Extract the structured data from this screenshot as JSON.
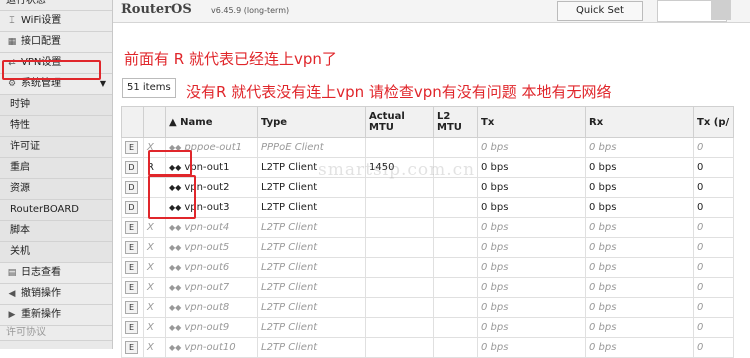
{
  "sidebar": {
    "top_cut": "运行状态",
    "items": [
      {
        "label": "WiFi设置",
        "icon": "wifi-icon",
        "glyph": "⌶"
      },
      {
        "label": "接口配置",
        "icon": "interface-icon",
        "glyph": "▦"
      },
      {
        "label": "VPN设置",
        "icon": "vpn-icon",
        "glyph": "⇄"
      },
      {
        "label": "系统管理",
        "icon": "gear-icon",
        "glyph": "⚙",
        "arrow": "▼"
      }
    ],
    "sub_items": [
      "时钟",
      "特性",
      "许可证",
      "重启",
      "资源",
      "RouterBOARD",
      "脚本",
      "关机"
    ],
    "bottom_items": [
      {
        "label": "日志查看",
        "icon": "log-icon",
        "glyph": "▤"
      },
      {
        "label": "撤销操作",
        "icon": "undo-icon",
        "glyph": "◀"
      },
      {
        "label": "重新操作",
        "icon": "redo-icon",
        "glyph": "▶"
      }
    ],
    "bottom_cut": "许可协议"
  },
  "header": {
    "brand": "RouterOS",
    "version": "v6.45.9 (long-term)",
    "quick_set": "Quick Set"
  },
  "annotations": {
    "line1": "前面有 R  就代表已经连上vpn了",
    "line2": "没有R 就代表没有连上vpn    请检查vpn有没有问题  本地有无网络"
  },
  "count_label": "51 items",
  "watermark": "smartsip.com.cn",
  "table": {
    "columns": [
      "",
      "",
      "▲ Name",
      "Type",
      "Actual MTU",
      "L2 MTU",
      "Tx",
      "Rx",
      "Tx (p/"
    ],
    "rows": [
      {
        "btn": "E",
        "flag": "X",
        "name": "pppoe-out1",
        "type": "PPPoE Client",
        "mtu": "",
        "l2mtu": "",
        "tx": "0 bps",
        "rx": "0 bps",
        "txp": "0",
        "disabled": true
      },
      {
        "btn": "D",
        "flag": "R",
        "name": "vpn-out1",
        "type": "L2TP Client",
        "mtu": "1450",
        "l2mtu": "",
        "tx": "0 bps",
        "rx": "0 bps",
        "txp": "0",
        "disabled": false
      },
      {
        "btn": "D",
        "flag": "",
        "name": "vpn-out2",
        "type": "L2TP Client",
        "mtu": "",
        "l2mtu": "",
        "tx": "0 bps",
        "rx": "0 bps",
        "txp": "0",
        "disabled": false
      },
      {
        "btn": "D",
        "flag": "",
        "name": "vpn-out3",
        "type": "L2TP Client",
        "mtu": "",
        "l2mtu": "",
        "tx": "0 bps",
        "rx": "0 bps",
        "txp": "0",
        "disabled": false
      },
      {
        "btn": "E",
        "flag": "X",
        "name": "vpn-out4",
        "type": "L2TP Client",
        "mtu": "",
        "l2mtu": "",
        "tx": "0 bps",
        "rx": "0 bps",
        "txp": "0",
        "disabled": true
      },
      {
        "btn": "E",
        "flag": "X",
        "name": "vpn-out5",
        "type": "L2TP Client",
        "mtu": "",
        "l2mtu": "",
        "tx": "0 bps",
        "rx": "0 bps",
        "txp": "0",
        "disabled": true
      },
      {
        "btn": "E",
        "flag": "X",
        "name": "vpn-out6",
        "type": "L2TP Client",
        "mtu": "",
        "l2mtu": "",
        "tx": "0 bps",
        "rx": "0 bps",
        "txp": "0",
        "disabled": true
      },
      {
        "btn": "E",
        "flag": "X",
        "name": "vpn-out7",
        "type": "L2TP Client",
        "mtu": "",
        "l2mtu": "",
        "tx": "0 bps",
        "rx": "0 bps",
        "txp": "0",
        "disabled": true
      },
      {
        "btn": "E",
        "flag": "X",
        "name": "vpn-out8",
        "type": "L2TP Client",
        "mtu": "",
        "l2mtu": "",
        "tx": "0 bps",
        "rx": "0 bps",
        "txp": "0",
        "disabled": true
      },
      {
        "btn": "E",
        "flag": "X",
        "name": "vpn-out9",
        "type": "L2TP Client",
        "mtu": "",
        "l2mtu": "",
        "tx": "0 bps",
        "rx": "0 bps",
        "txp": "0",
        "disabled": true
      },
      {
        "btn": "E",
        "flag": "X",
        "name": "vpn-out10",
        "type": "L2TP Client",
        "mtu": "",
        "l2mtu": "",
        "tx": "0 bps",
        "rx": "0 bps",
        "txp": "0",
        "disabled": true
      }
    ]
  },
  "colors": {
    "annotation_red": "#e0262b",
    "sidebar_bg": "#e9e9e9"
  }
}
